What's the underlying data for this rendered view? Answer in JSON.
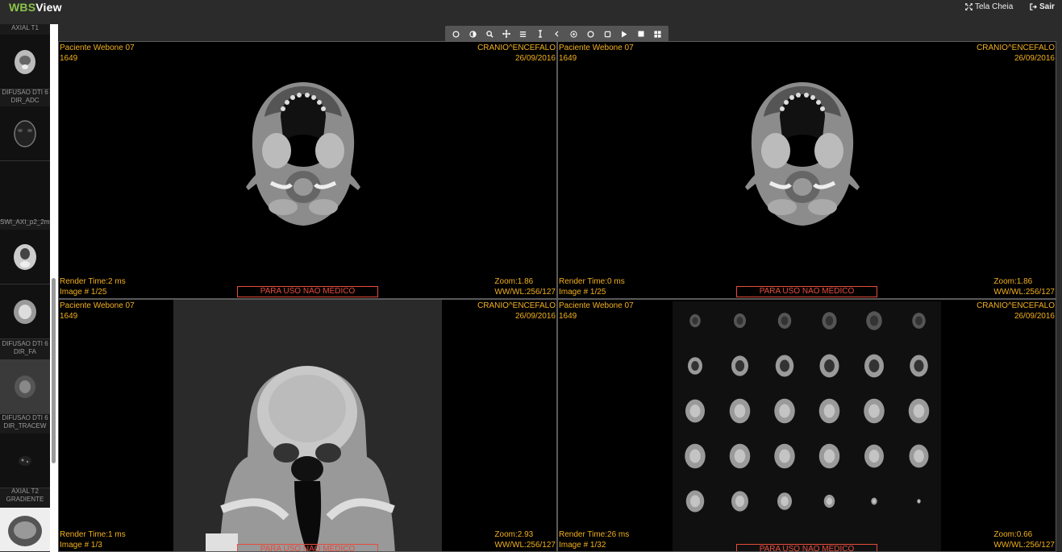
{
  "app": {
    "logo_prefix": "WBS",
    "logo_suffix": "View"
  },
  "header": {
    "fullscreen_label": "Tela Cheia",
    "exit_label": "Sair"
  },
  "sidebar": {
    "series": [
      {
        "label": "AXIAL T1",
        "label2": ""
      },
      {
        "label": "DIFUSAO DTI 6",
        "label2": "DIR_ADC"
      },
      {
        "label": "SWI_AXI_p2_2mm",
        "label2": ""
      },
      {
        "label": "DIFUSAO DTI 6",
        "label2": "DIR_FA"
      },
      {
        "label": "DIFUSAO DTI 6",
        "label2": "DIR_TRACEW"
      },
      {
        "label": "AXIAL T2",
        "label2": "GRADIENTE"
      }
    ]
  },
  "toolbar": {
    "tools": [
      "window-level-icon",
      "contrast-icon",
      "zoom-icon",
      "pan-icon",
      "stack-icon",
      "length-icon",
      "previous-icon",
      "target-icon",
      "ellipse-roi-icon",
      "rectangle-roi-icon",
      "play-icon",
      "stop-icon",
      "layout-icon"
    ]
  },
  "viewports": [
    {
      "patient": "Paciente Webone 07",
      "id": "1649",
      "study": "CRANIO^ENCEFALO",
      "date": "26/09/2016",
      "render": "Render Time:2 ms",
      "image": "Image # 1/25",
      "zoom": "Zoom:1.86",
      "wwwl": "WW/WL:256/127",
      "banner": "PARA USO NÃO MÉDICO"
    },
    {
      "patient": "Paciente Webone 07",
      "id": "1649",
      "study": "CRANIO^ENCEFALO",
      "date": "26/09/2016",
      "render": "Render Time:0 ms",
      "image": "Image # 1/25",
      "zoom": "Zoom:1.86",
      "wwwl": "WW/WL:256/127",
      "banner": "PARA USO NÃO MÉDICO"
    },
    {
      "patient": "Paciente Webone 07",
      "id": "1649",
      "study": "CRANIO^ENCEFALO",
      "date": "26/09/2016",
      "render": "Render Time:1 ms",
      "image": "Image # 1/3",
      "zoom": "Zoom:2.93",
      "wwwl": "WW/WL:256/127",
      "banner": "PARA USO NÃO MÉDICO"
    },
    {
      "patient": "Paciente Webone 07",
      "id": "1649",
      "study": "CRANIO^ENCEFALO",
      "date": "26/09/2016",
      "render": "Render Time:26 ms",
      "image": "Image # 1/32",
      "zoom": "Zoom:0.66",
      "wwwl": "WW/WL:256/127",
      "banner": "PARA USO NÃO MÉDICO"
    }
  ]
}
